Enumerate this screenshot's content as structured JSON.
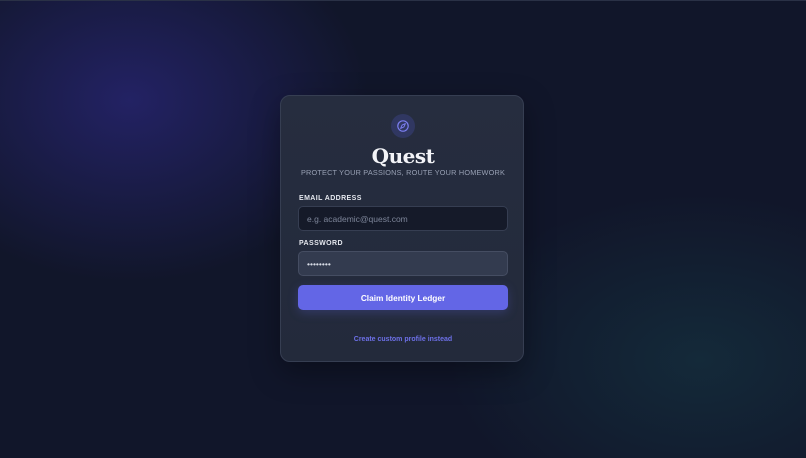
{
  "app": {
    "brand_name": "Quest",
    "tagline": "PROTECT YOUR PASSIONS, ROUTE YOUR HOMEWORK",
    "logo_icon": "compass-icon"
  },
  "form": {
    "email": {
      "label": "EMAIL ADDRESS",
      "placeholder": "e.g. academic@quest.com",
      "value": ""
    },
    "password": {
      "label": "PASSWORD",
      "value": "••••••••"
    },
    "submit_label": "Claim Identity Ledger",
    "alt_link_label": "Create custom profile instead"
  },
  "colors": {
    "accent": "#6366e6",
    "background": "#11162a",
    "card": "#252c3e",
    "link": "#6d70e8"
  }
}
